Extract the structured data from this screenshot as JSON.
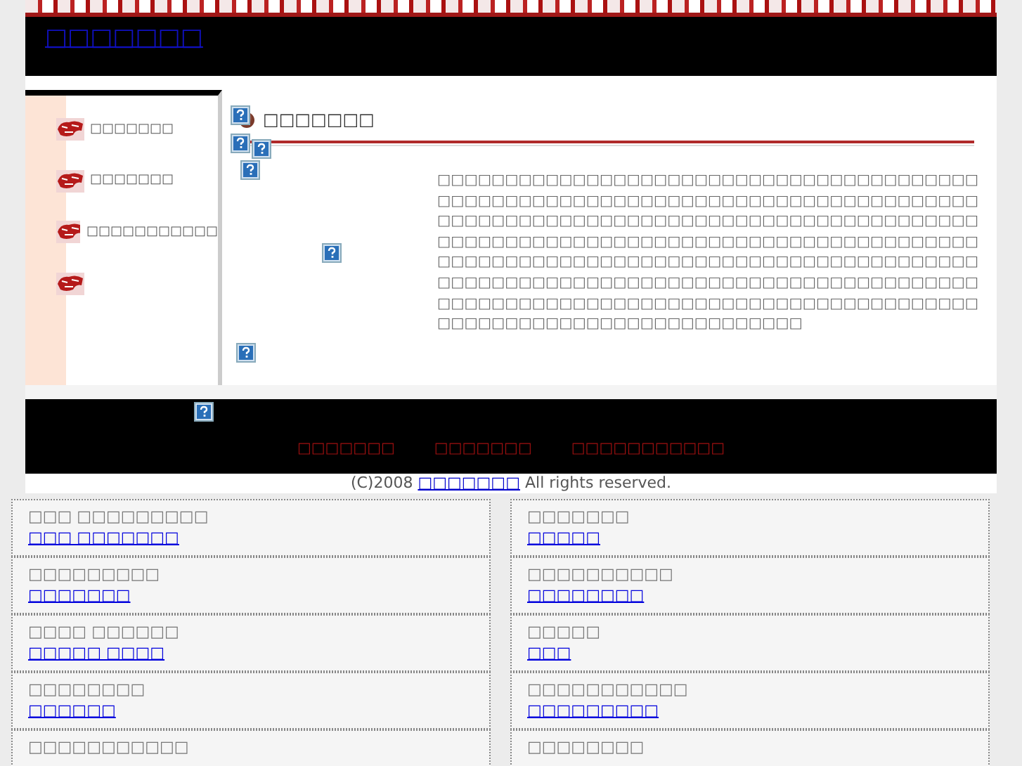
{
  "header": {
    "title": "□□□□□□□"
  },
  "sidebar": {
    "items": [
      {
        "label": "□□□□□□□"
      },
      {
        "label": "□□□□□□□"
      },
      {
        "label": "□□□□□□□□□□□"
      }
    ]
  },
  "main": {
    "heading": "□□□□□□□",
    "paragraph": "□□□□□□□□□□□□□□□□□□□□□□□□□□□□□□□□□□□□□□□□□□□□□□□□□□□□□□□□□□□□□□□□□□□□□□□□□□□□□□□□□□□□□□□□□□□□□□□□□□□□□□□□□□□□□□□□□□□□□□□□□□□□□□□□□□□□□□□□□□□□□□□□□□□□□□□□□□□□□□□□□□□□□□□□□□□□□□□□□□□□□□□□□□□□□□□□□□□□□□□□□□□□□□□□□□□□□□□□□□□□□□□□□□□□□□□□□□□□□□□□□□□□□□□□□□□□□□□□□□□□□□□□□□□□□□□□□□□□□□□□□□□□□□□□□□□□□□□□□□□□□□□□□□□"
  },
  "footer": {
    "links": [
      "□□□□□□□",
      "□□□□□□□",
      "□□□□□□□□□□□"
    ],
    "copyright_prefix": "(C)2008",
    "copyright_link": "□□□□□□□",
    "copyright_suffix": "All rights reserved."
  },
  "listings": [
    {
      "title": "□□□ □□□□□□□□□",
      "link": "□□□ □□□□□□□"
    },
    {
      "title": "□□□□□□□",
      "link": "□□□□□"
    },
    {
      "title": "□□□□□□□□□",
      "link": "□□□□□□□"
    },
    {
      "title": "□□□□□□□□□□",
      "link": "□□□□□□□□"
    },
    {
      "title": "□□□□ □□□□□□",
      "link": "□□□□□ □□□□"
    },
    {
      "title": "□□□□□",
      "link": "□□□"
    },
    {
      "title": "□□□□□□□□",
      "link": "□□□□□□"
    },
    {
      "title": "□□□□□□□□□□□",
      "link": "□□□□□□□□□"
    },
    {
      "title": "□□□□□□□□□□□"
    },
    {
      "title": "□□□□□□□□"
    }
  ]
}
